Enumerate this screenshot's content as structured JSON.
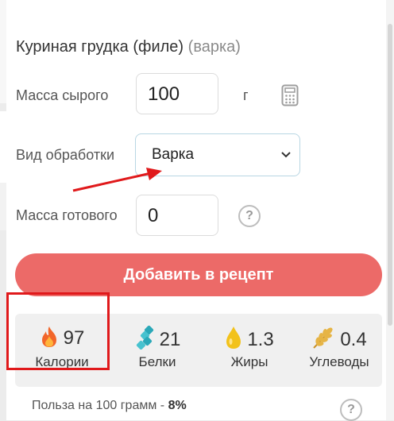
{
  "product": {
    "name": "Куриная грудка (филе)",
    "method_suffix": "(варка)"
  },
  "fields": {
    "raw_mass_label": "Масса сырого",
    "raw_mass_value": "100",
    "raw_mass_unit": "г",
    "method_label": "Вид обработки",
    "method_selected": "Варка",
    "cooked_mass_label": "Масса готового",
    "cooked_mass_value": "0"
  },
  "help_glyph": "?",
  "add_button": "Добавить в рецепт",
  "nutrients": [
    {
      "icon": "fire-icon",
      "value": "97",
      "label": "Калории"
    },
    {
      "icon": "protein-chain-icon",
      "value": "21",
      "label": "Белки"
    },
    {
      "icon": "oil-drop-icon",
      "value": "1.3",
      "label": "Жиры"
    },
    {
      "icon": "wheat-icon",
      "value": "0.4",
      "label": "Углеводы"
    }
  ],
  "benefit": {
    "text": "Польза на 100 грамм -",
    "value": "8%"
  },
  "colors": {
    "accent": "#ec6a68",
    "highlight": "#e0191b",
    "select_border": "#b8d6e3"
  }
}
